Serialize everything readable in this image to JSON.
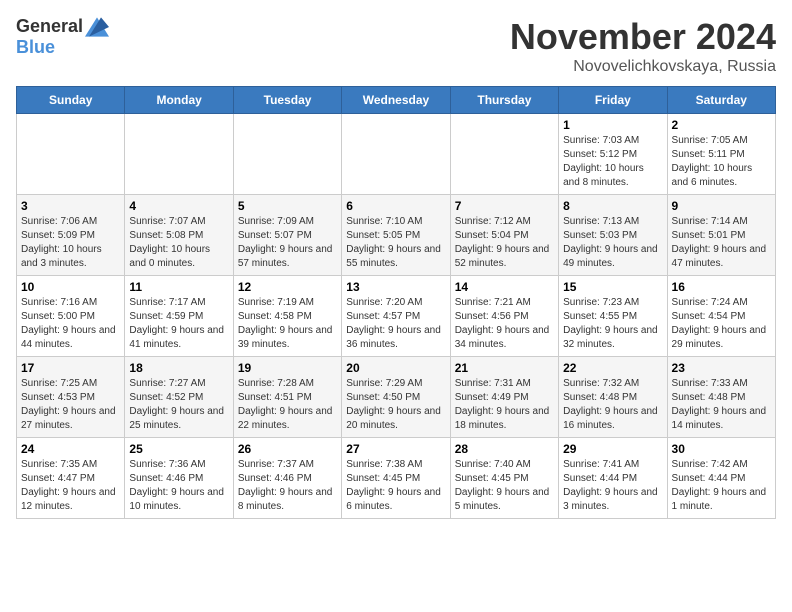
{
  "logo": {
    "general": "General",
    "blue": "Blue"
  },
  "title": {
    "month": "November 2024",
    "location": "Novovelichkovskaya, Russia"
  },
  "weekdays": [
    "Sunday",
    "Monday",
    "Tuesday",
    "Wednesday",
    "Thursday",
    "Friday",
    "Saturday"
  ],
  "weeks": [
    [
      {
        "day": "",
        "info": ""
      },
      {
        "day": "",
        "info": ""
      },
      {
        "day": "",
        "info": ""
      },
      {
        "day": "",
        "info": ""
      },
      {
        "day": "",
        "info": ""
      },
      {
        "day": "1",
        "info": "Sunrise: 7:03 AM\nSunset: 5:12 PM\nDaylight: 10 hours and 8 minutes."
      },
      {
        "day": "2",
        "info": "Sunrise: 7:05 AM\nSunset: 5:11 PM\nDaylight: 10 hours and 6 minutes."
      }
    ],
    [
      {
        "day": "3",
        "info": "Sunrise: 7:06 AM\nSunset: 5:09 PM\nDaylight: 10 hours and 3 minutes."
      },
      {
        "day": "4",
        "info": "Sunrise: 7:07 AM\nSunset: 5:08 PM\nDaylight: 10 hours and 0 minutes."
      },
      {
        "day": "5",
        "info": "Sunrise: 7:09 AM\nSunset: 5:07 PM\nDaylight: 9 hours and 57 minutes."
      },
      {
        "day": "6",
        "info": "Sunrise: 7:10 AM\nSunset: 5:05 PM\nDaylight: 9 hours and 55 minutes."
      },
      {
        "day": "7",
        "info": "Sunrise: 7:12 AM\nSunset: 5:04 PM\nDaylight: 9 hours and 52 minutes."
      },
      {
        "day": "8",
        "info": "Sunrise: 7:13 AM\nSunset: 5:03 PM\nDaylight: 9 hours and 49 minutes."
      },
      {
        "day": "9",
        "info": "Sunrise: 7:14 AM\nSunset: 5:01 PM\nDaylight: 9 hours and 47 minutes."
      }
    ],
    [
      {
        "day": "10",
        "info": "Sunrise: 7:16 AM\nSunset: 5:00 PM\nDaylight: 9 hours and 44 minutes."
      },
      {
        "day": "11",
        "info": "Sunrise: 7:17 AM\nSunset: 4:59 PM\nDaylight: 9 hours and 41 minutes."
      },
      {
        "day": "12",
        "info": "Sunrise: 7:19 AM\nSunset: 4:58 PM\nDaylight: 9 hours and 39 minutes."
      },
      {
        "day": "13",
        "info": "Sunrise: 7:20 AM\nSunset: 4:57 PM\nDaylight: 9 hours and 36 minutes."
      },
      {
        "day": "14",
        "info": "Sunrise: 7:21 AM\nSunset: 4:56 PM\nDaylight: 9 hours and 34 minutes."
      },
      {
        "day": "15",
        "info": "Sunrise: 7:23 AM\nSunset: 4:55 PM\nDaylight: 9 hours and 32 minutes."
      },
      {
        "day": "16",
        "info": "Sunrise: 7:24 AM\nSunset: 4:54 PM\nDaylight: 9 hours and 29 minutes."
      }
    ],
    [
      {
        "day": "17",
        "info": "Sunrise: 7:25 AM\nSunset: 4:53 PM\nDaylight: 9 hours and 27 minutes."
      },
      {
        "day": "18",
        "info": "Sunrise: 7:27 AM\nSunset: 4:52 PM\nDaylight: 9 hours and 25 minutes."
      },
      {
        "day": "19",
        "info": "Sunrise: 7:28 AM\nSunset: 4:51 PM\nDaylight: 9 hours and 22 minutes."
      },
      {
        "day": "20",
        "info": "Sunrise: 7:29 AM\nSunset: 4:50 PM\nDaylight: 9 hours and 20 minutes."
      },
      {
        "day": "21",
        "info": "Sunrise: 7:31 AM\nSunset: 4:49 PM\nDaylight: 9 hours and 18 minutes."
      },
      {
        "day": "22",
        "info": "Sunrise: 7:32 AM\nSunset: 4:48 PM\nDaylight: 9 hours and 16 minutes."
      },
      {
        "day": "23",
        "info": "Sunrise: 7:33 AM\nSunset: 4:48 PM\nDaylight: 9 hours and 14 minutes."
      }
    ],
    [
      {
        "day": "24",
        "info": "Sunrise: 7:35 AM\nSunset: 4:47 PM\nDaylight: 9 hours and 12 minutes."
      },
      {
        "day": "25",
        "info": "Sunrise: 7:36 AM\nSunset: 4:46 PM\nDaylight: 9 hours and 10 minutes."
      },
      {
        "day": "26",
        "info": "Sunrise: 7:37 AM\nSunset: 4:46 PM\nDaylight: 9 hours and 8 minutes."
      },
      {
        "day": "27",
        "info": "Sunrise: 7:38 AM\nSunset: 4:45 PM\nDaylight: 9 hours and 6 minutes."
      },
      {
        "day": "28",
        "info": "Sunrise: 7:40 AM\nSunset: 4:45 PM\nDaylight: 9 hours and 5 minutes."
      },
      {
        "day": "29",
        "info": "Sunrise: 7:41 AM\nSunset: 4:44 PM\nDaylight: 9 hours and 3 minutes."
      },
      {
        "day": "30",
        "info": "Sunrise: 7:42 AM\nSunset: 4:44 PM\nDaylight: 9 hours and 1 minute."
      }
    ]
  ]
}
